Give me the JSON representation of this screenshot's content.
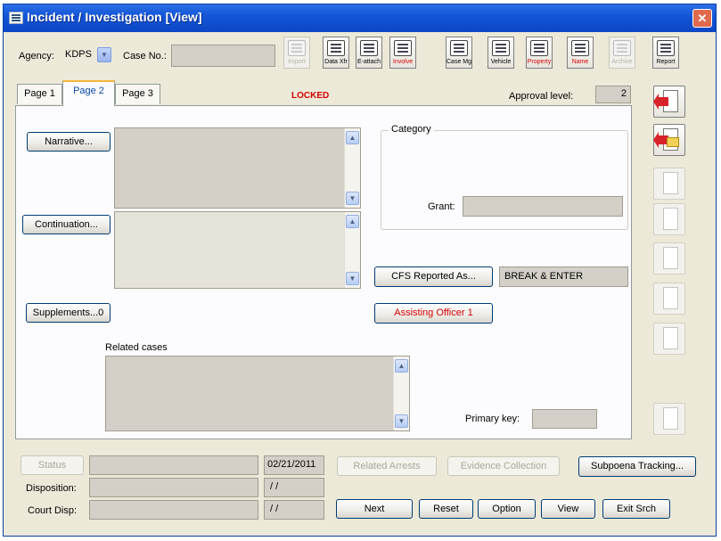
{
  "window": {
    "title": "Incident / Investigation [View]",
    "close_glyph": "✕"
  },
  "top": {
    "agency_label": "Agency:",
    "agency_value": "KDPS",
    "case_no_label": "Case No.:",
    "case_no_value": ""
  },
  "toolbar": [
    {
      "label": "Import",
      "icon": "import-icon",
      "enabled": false,
      "red": false
    },
    {
      "label": "Data Xfr",
      "icon": "data-transfer-icon",
      "enabled": true,
      "red": false
    },
    {
      "label": "E-attach",
      "icon": "attach-icon",
      "enabled": true,
      "red": false
    },
    {
      "label": "Involve",
      "icon": "involve-icon",
      "enabled": true,
      "red": true
    },
    {
      "label": "Case Mgt",
      "icon": "case-management-icon",
      "enabled": true,
      "red": false
    },
    {
      "label": "Vehicle",
      "icon": "vehicle-icon",
      "enabled": true,
      "red": false
    },
    {
      "label": "Property",
      "icon": "property-icon",
      "enabled": true,
      "red": true
    },
    {
      "label": "Name",
      "icon": "name-icon",
      "enabled": true,
      "red": true
    },
    {
      "label": "Archive",
      "icon": "archive-icon",
      "enabled": false,
      "red": false
    },
    {
      "label": "Report",
      "icon": "report-icon",
      "enabled": true,
      "red": false
    }
  ],
  "tabs": [
    "Page 1",
    "Page 2",
    "Page 3"
  ],
  "active_tab": "Page 2",
  "status": {
    "locked": "LOCKED",
    "approval_label": "Approval level:",
    "approval_value": "2"
  },
  "buttons": {
    "narrative": "Narrative...",
    "continuation": "Continuation...",
    "supplements": "Supplements...0",
    "cfs_reported": "CFS Reported As...",
    "assisting_officer": "Assisting Officer 1"
  },
  "category": {
    "title": "Category",
    "grant_label": "Grant:",
    "grant_value": ""
  },
  "cfs_value": "BREAK & ENTER",
  "related_cases_label": "Related cases",
  "primary_key_label": "Primary key:",
  "primary_key_value": "",
  "bottom": {
    "status_btn": "Status",
    "status_value": "",
    "date_value": "02/21/2011",
    "disposition_label": "Disposition:",
    "disposition_value": "",
    "disposition_date": "/ /",
    "court_disp_label": "Court Disp:",
    "court_disp_value": "",
    "court_disp_date": "/ /",
    "related_arrests": "Related Arrests",
    "evidence_collection": "Evidence Collection",
    "subpoena_tracking": "Subpoena Tracking...",
    "next": "Next",
    "reset": "Reset",
    "option": "Option",
    "view": "View",
    "exit_search": "Exit Srch"
  },
  "colors": {
    "title_bar": "#1456d8",
    "accent_red": "#d40000",
    "window_bg": "#ece9d8",
    "tab_highlight": "#f3b63f"
  }
}
